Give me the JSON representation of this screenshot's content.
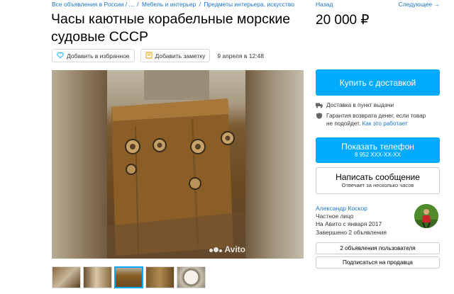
{
  "breadcrumbs": [
    "Все объявления в России / ...",
    "Мебель и интерьер",
    "Предметы интерьера, искусство"
  ],
  "breadcrumb_sep": "/",
  "title": "Часы каютные корабельные морские судовые СССР",
  "actions": {
    "favorite": "Добавить в избранное",
    "note": "Добавить заметку",
    "date": "9 апреля в 12:48"
  },
  "photo": {
    "watermark": "Avito"
  },
  "nav": {
    "back": "Назад",
    "next": "Следующее →"
  },
  "price": "20 000 ₽",
  "buy_button": "Купить с доставкой",
  "delivery_text": "Доставка в пункт выдачи",
  "guarantee": {
    "text_line1": "Гарантия возврата денег, если товар",
    "text_line2": "не подойдет.",
    "link": "Как это работает"
  },
  "phone_button": {
    "label": "Показать телефон",
    "number": "8 952 XXX-XX-XX"
  },
  "message_button": {
    "label": "Написать сообщение",
    "sub": "Отвечает за несколько часов"
  },
  "seller": {
    "name": "Александр Коскор",
    "type": "Частное лицо",
    "since": "На Авито с января 2017",
    "completed": "Завершено 2 объявления"
  },
  "seller_ads_button": "2 объявления пользователя",
  "subscribe_button": "Подписаться на продавца",
  "colors": {
    "accent": "#00aaff",
    "link": "#1976d2"
  },
  "icons": [
    "heart-icon",
    "note-icon",
    "truck-icon",
    "shield-icon"
  ]
}
